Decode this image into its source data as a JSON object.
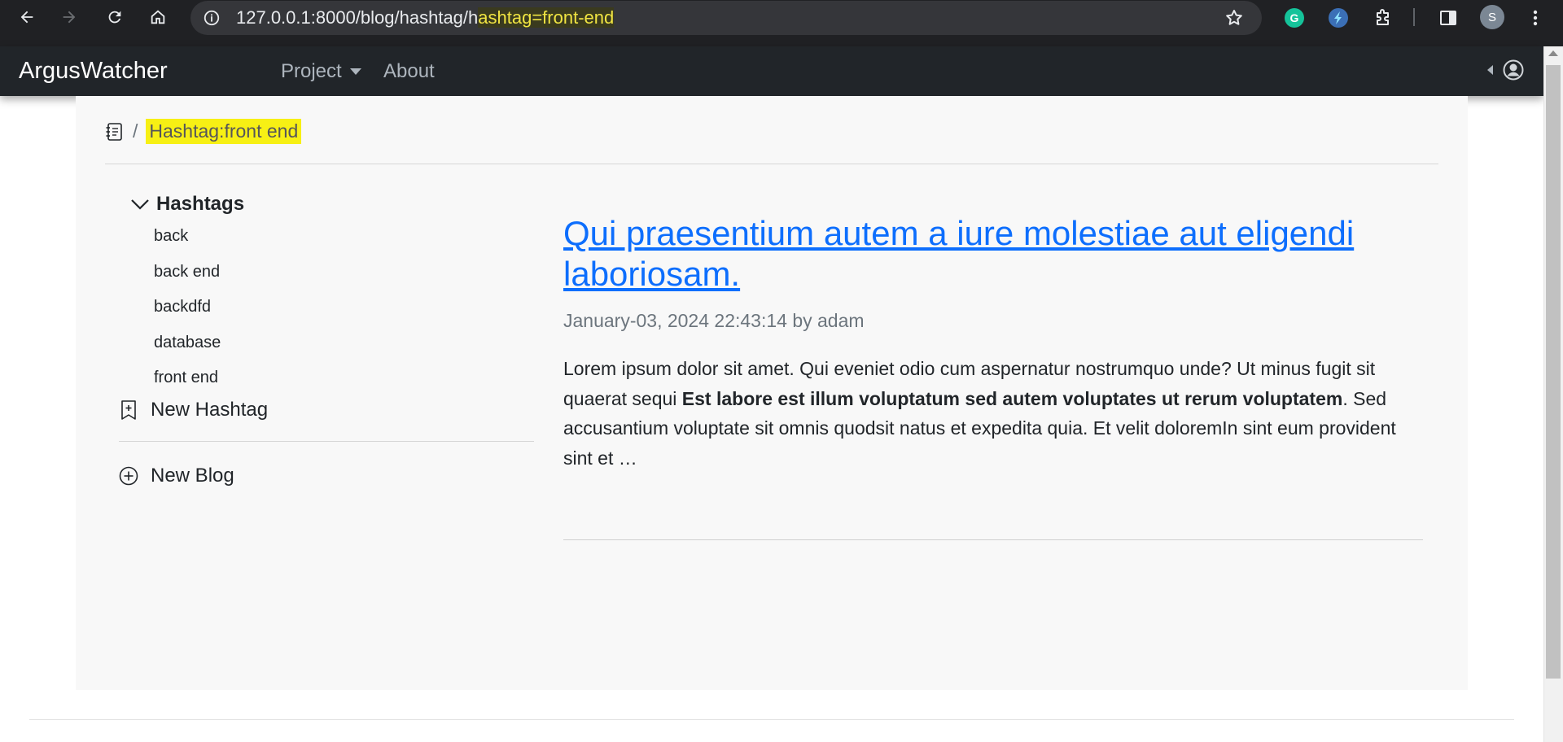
{
  "browser": {
    "url_plain": "127.0.0.1:8000/blog/hashtag/h",
    "url_highlight": "ashtag=front-end",
    "profile_initial": "S"
  },
  "navbar": {
    "brand": "ArgusWatcher",
    "links": [
      {
        "label": "Project",
        "dropdown": true
      },
      {
        "label": "About",
        "dropdown": false
      }
    ]
  },
  "breadcrumb": {
    "current": "Hashtag:front end"
  },
  "sidebar": {
    "section_title": "Hashtags",
    "hashtags": [
      "back",
      "back end",
      "backdfd",
      "database",
      "front end"
    ],
    "new_hashtag_label": "New Hashtag",
    "new_blog_label": "New Blog"
  },
  "post": {
    "title": "Qui praesentium autem a iure molestiae aut eligendi laboriosam.",
    "meta": "January-03, 2024 22:43:14 by adam",
    "excerpt_before": "Lorem ipsum dolor sit amet. Qui eveniet odio cum aspernatur nostrumquo unde? Ut minus fugit sit quaerat sequi ",
    "excerpt_bold": "Est labore est illum voluptatum sed autem voluptates ut rerum voluptatem",
    "excerpt_after": ". Sed accusantium voluptate sit omnis quodsit natus et expedita quia. Et velit doloremIn sint eum provident sint et …"
  },
  "colors": {
    "navbar_bg": "#212529",
    "link": "#0d6efd",
    "highlight": "#f7f014"
  }
}
